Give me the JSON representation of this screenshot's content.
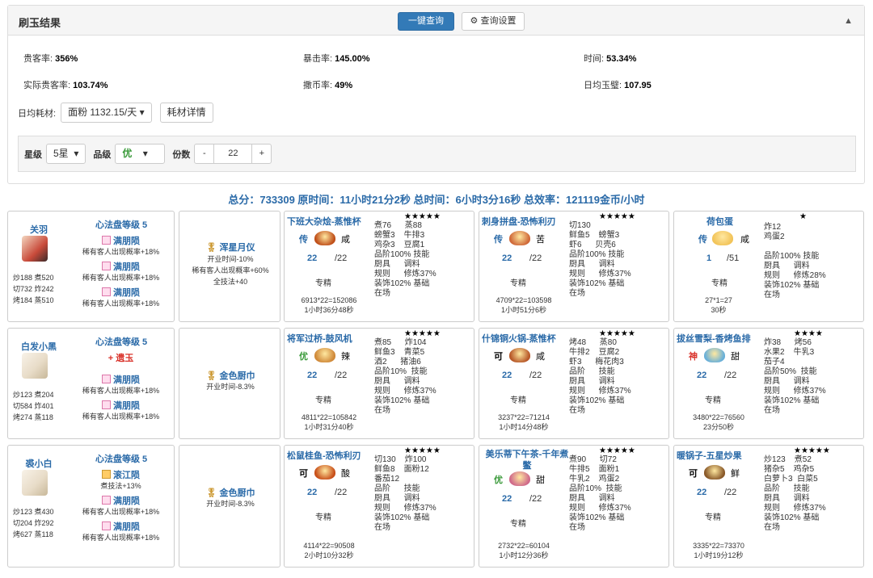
{
  "panel": {
    "title": "刷玉结果",
    "query_button": "一键查询",
    "settings_button": "查询设置",
    "gear_icon": "gear-icon",
    "collapse_icon": "chevron-up-icon"
  },
  "stats": {
    "guest_rate_label": "贵客率:",
    "guest_rate": "356%",
    "crit_rate_label": "暴击率:",
    "crit_rate": "145.00%",
    "time_label": "时间:",
    "time": "53.34%",
    "actual_guest_rate_label": "实际贵客率:",
    "actual_guest_rate": "103.74%",
    "coin_rate_label": "撒币率:",
    "coin_rate": "49%",
    "daily_jade_label": "日均玉璧:",
    "daily_jade": "107.95"
  },
  "consumption": {
    "label": "日均耗材:",
    "selected": "面粉 1132.15/天",
    "detail_button": "耗材详情"
  },
  "filters": {
    "star_label": "星级",
    "star_value": "5星",
    "grade_label": "品级",
    "grade_value": "优",
    "portion_label": "份数",
    "minus": "-",
    "portion_value": "22",
    "plus": "+"
  },
  "summary": "总分：733309 原时间：11小时21分2秒 总时间：6小时3分16秒 总效率：121119金币/小时",
  "chefs": [
    {
      "name": "关羽",
      "stats": [
        "炒188 煮520",
        "切732 炸242",
        "烤184 蒸510"
      ],
      "skill_title": "心法盘等级 5",
      "extra": "",
      "extra_desc": "",
      "auras": [
        {
          "name": "满朋陨",
          "desc": "稀有客人出现概率+18%"
        },
        {
          "name": "满朋陨",
          "desc": "稀有客人出现概率+18%"
        },
        {
          "name": "满朋陨",
          "desc": "稀有客人出现概率+18%"
        }
      ],
      "equip_name": "浑星月仪",
      "equip_desc": [
        "开业时间-10%",
        "稀有客人出现概率+60%",
        "全技法+40"
      ],
      "recipes": [
        {
          "title": "下班大杂烩-蒸惟杯",
          "stars": "★★★★★",
          "rank": "传",
          "rank_color": "#2a6aa8",
          "taste": "咸",
          "qty": "22",
          "total": "/22",
          "mats": "煮76      蒸88\n螃蟹3    牛排3\n鸡杂3    豆腐1\n品阶100% 技能\n厨具      调料\n规则      修炼37%\n装饰102% 基础\n在场",
          "calc": "6913*22=152086",
          "time": "1小时36分48秒",
          "dish_color": "#c0501a"
        },
        {
          "title": "刺身拼盘-恐怖利刃",
          "stars": "★★★★★",
          "rank": "传",
          "rank_color": "#2a6aa8",
          "taste": "苦",
          "qty": "22",
          "total": "/22",
          "mats": "切130\n鲜鱼5    螃蟹3\n虾6      贝壳6\n品阶100% 技能\n厨具      调料\n规则      修炼37%\n装饰102% 基础\n在场",
          "calc": "4709*22=103598",
          "time": "1小时51分6秒",
          "dish_color": "#d06a3a"
        },
        {
          "title": "荷包蛋",
          "stars": "★",
          "rank": "传",
          "rank_color": "#2a6aa8",
          "taste": "咸",
          "qty": "1",
          "total": "/51",
          "mats": "炸12\n鸡蛋2\n\n品阶100% 技能\n厨具      调料\n规则      修炼28%\n装饰102% 基础\n在场",
          "calc": "27*1=27",
          "time": "30秒",
          "dish_color": "#f2c45a"
        }
      ]
    },
    {
      "name": "白发小黑",
      "stats": [
        "炒123 煮204",
        "切584 炸401",
        "烤274 蒸118"
      ],
      "skill_title": "心法盘等级 5",
      "extra": "+ 遗玉",
      "extra_desc": "",
      "auras": [
        {
          "name": "满朋陨",
          "desc": "稀有客人出现概率+18%"
        },
        {
          "name": "满朋陨",
          "desc": "稀有客人出现概率+18%"
        }
      ],
      "equip_name": "金色厨巾",
      "equip_desc": [
        "开业时间-8.3%"
      ],
      "recipes": [
        {
          "title": "将军过桥-鼓风机",
          "stars": "★★★★★",
          "rank": "优",
          "rank_color": "#3a9a3a",
          "taste": "辣",
          "qty": "22",
          "total": "/22",
          "mats": "煮85      炸104\n鲜鱼3    青菜5\n酒2      猪油6\n品阶10%  技能\n厨具      调料\n规则      修炼37%\n装饰102% 基础\n在场",
          "calc": "4811*22=105842",
          "time": "1小时31分40秒",
          "dish_color": "#d08a3a"
        },
        {
          "title": "什锦铜火锅-蒸惟杯",
          "stars": "★★★★★",
          "rank": "可",
          "rank_color": "#000",
          "taste": "咸",
          "qty": "22",
          "total": "/22",
          "mats": "烤48      蒸80\n牛排2    豆腐2\n虾3      梅花肉3\n品阶      技能\n厨具      调料\n规则      修炼37%\n装饰102% 基础\n在场",
          "calc": "3237*22=71214",
          "time": "1小时14分48秒",
          "dish_color": "#b85a2a"
        },
        {
          "title": "拔丝雪梨-香烤鱼排",
          "stars": "★★★★",
          "rank": "神",
          "rank_color": "#d9322a",
          "taste": "甜",
          "qty": "22",
          "total": "/22",
          "mats": "炸38      烤56\n水果2    牛乳3\n茄子4\n品阶50%  技能\n厨具      调料\n规则      修炼37%\n装饰102% 基础\n在场",
          "calc": "3480*22=76560",
          "time": "23分50秒",
          "dish_color": "#6ab0d8"
        }
      ]
    },
    {
      "name": "裘小白",
      "stats": [
        "炒123 煮430",
        "切204 炸292",
        "烤627 蒸118"
      ],
      "skill_title": "心法盘等级 5",
      "extra": "滚江陨",
      "extra_desc": "煮技法+13%",
      "auras": [
        {
          "name": "满朋陨",
          "desc": "稀有客人出现概率+18%"
        },
        {
          "name": "满朋陨",
          "desc": "稀有客人出现概率+18%"
        }
      ],
      "equip_name": "金色厨巾",
      "equip_desc": [
        "开业时间-8.3%"
      ],
      "recipes": [
        {
          "title": "松鼠桂鱼-恐怖利刃",
          "stars": "★★★★★",
          "rank": "可",
          "rank_color": "#000",
          "taste": "酸",
          "qty": "22",
          "total": "/22",
          "mats": "切130    炸100\n鲜鱼8    面粉12\n番茄12\n品阶      技能\n厨具      调料\n规则      修炼37%\n装饰102% 基础\n在场",
          "calc": "4114*22=90508",
          "time": "2小时10分32秒",
          "dish_color": "#c8501a"
        },
        {
          "title": "美乐蒂下午茶-千年煮鳖",
          "stars": "★★★★★",
          "rank": "优",
          "rank_color": "#3a9a3a",
          "taste": "甜",
          "qty": "22",
          "total": "/22",
          "mats": "煮90      切72\n牛排5    面粉1\n牛乳2    鸡蛋2\n品阶10%  技能\n厨具      调料\n规则      修炼37%\n装饰102% 基础\n在场",
          "calc": "2732*22=60104",
          "time": "1小时12分36秒",
          "dish_color": "#d06a8a"
        },
        {
          "title": "暖锅子-五星炒果",
          "stars": "★★★★★",
          "rank": "可",
          "rank_color": "#000",
          "taste": "鲜",
          "qty": "22",
          "total": "/22",
          "mats": "炒123    煮52\n猪杂5    鸡杂5\n白萝卜3  白菜5\n品阶      技能\n厨具      调料\n规则      修炼37%\n装饰102% 基础\n在场",
          "calc": "3335*22=73370",
          "time": "1小时19分12秒",
          "dish_color": "#8a5a2a"
        }
      ]
    }
  ]
}
